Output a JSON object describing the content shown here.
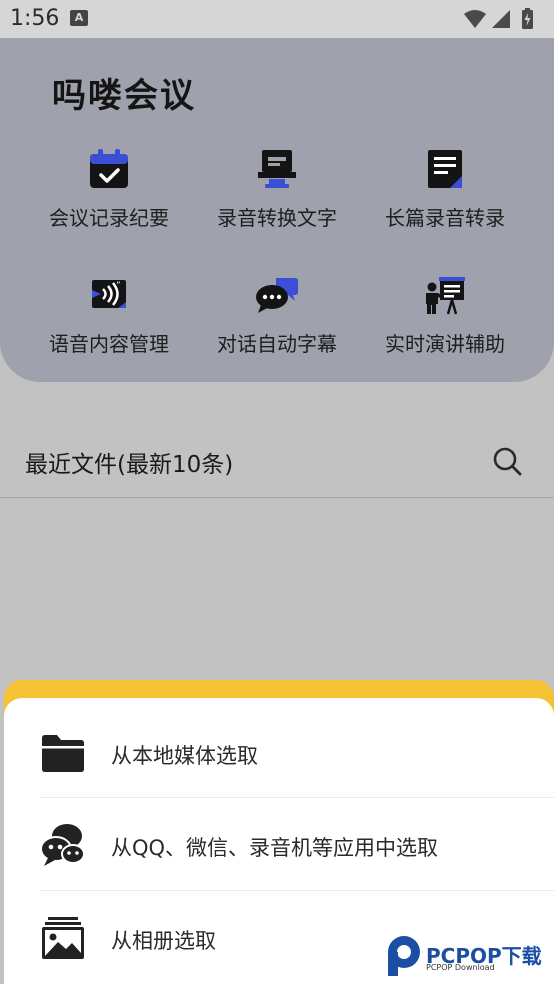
{
  "status_bar": {
    "time": "1:56",
    "notification_letter": "A"
  },
  "app": {
    "title": "吗喽会议"
  },
  "features": [
    {
      "label": "会议记录纪要",
      "icon": "calendar-check-icon"
    },
    {
      "label": "录音转换文字",
      "icon": "monitor-icon"
    },
    {
      "label": "长篇录音转录",
      "icon": "document-icon"
    },
    {
      "label": "语音内容管理",
      "icon": "voice-card-icon"
    },
    {
      "label": "对话自动字幕",
      "icon": "chat-bubbles-icon"
    },
    {
      "label": "实时演讲辅助",
      "icon": "presentation-icon"
    }
  ],
  "recent": {
    "title": "最近文件(最新10条)",
    "search_icon": "search-icon"
  },
  "sheet": {
    "items": [
      {
        "label": "从本地媒体选取",
        "icon": "folder-icon"
      },
      {
        "label": "从QQ、微信、录音机等应用中选取",
        "icon": "chat-group-icon"
      },
      {
        "label": "从相册选取",
        "icon": "gallery-icon"
      }
    ],
    "accent_color": "#f4c232"
  },
  "watermark": {
    "brand": "PCPOP下载",
    "sub": "PCPOP Download"
  },
  "colors": {
    "header_card": "#9fa2ad",
    "icon_blue": "#3a4fd6",
    "icon_dark": "#141414"
  }
}
